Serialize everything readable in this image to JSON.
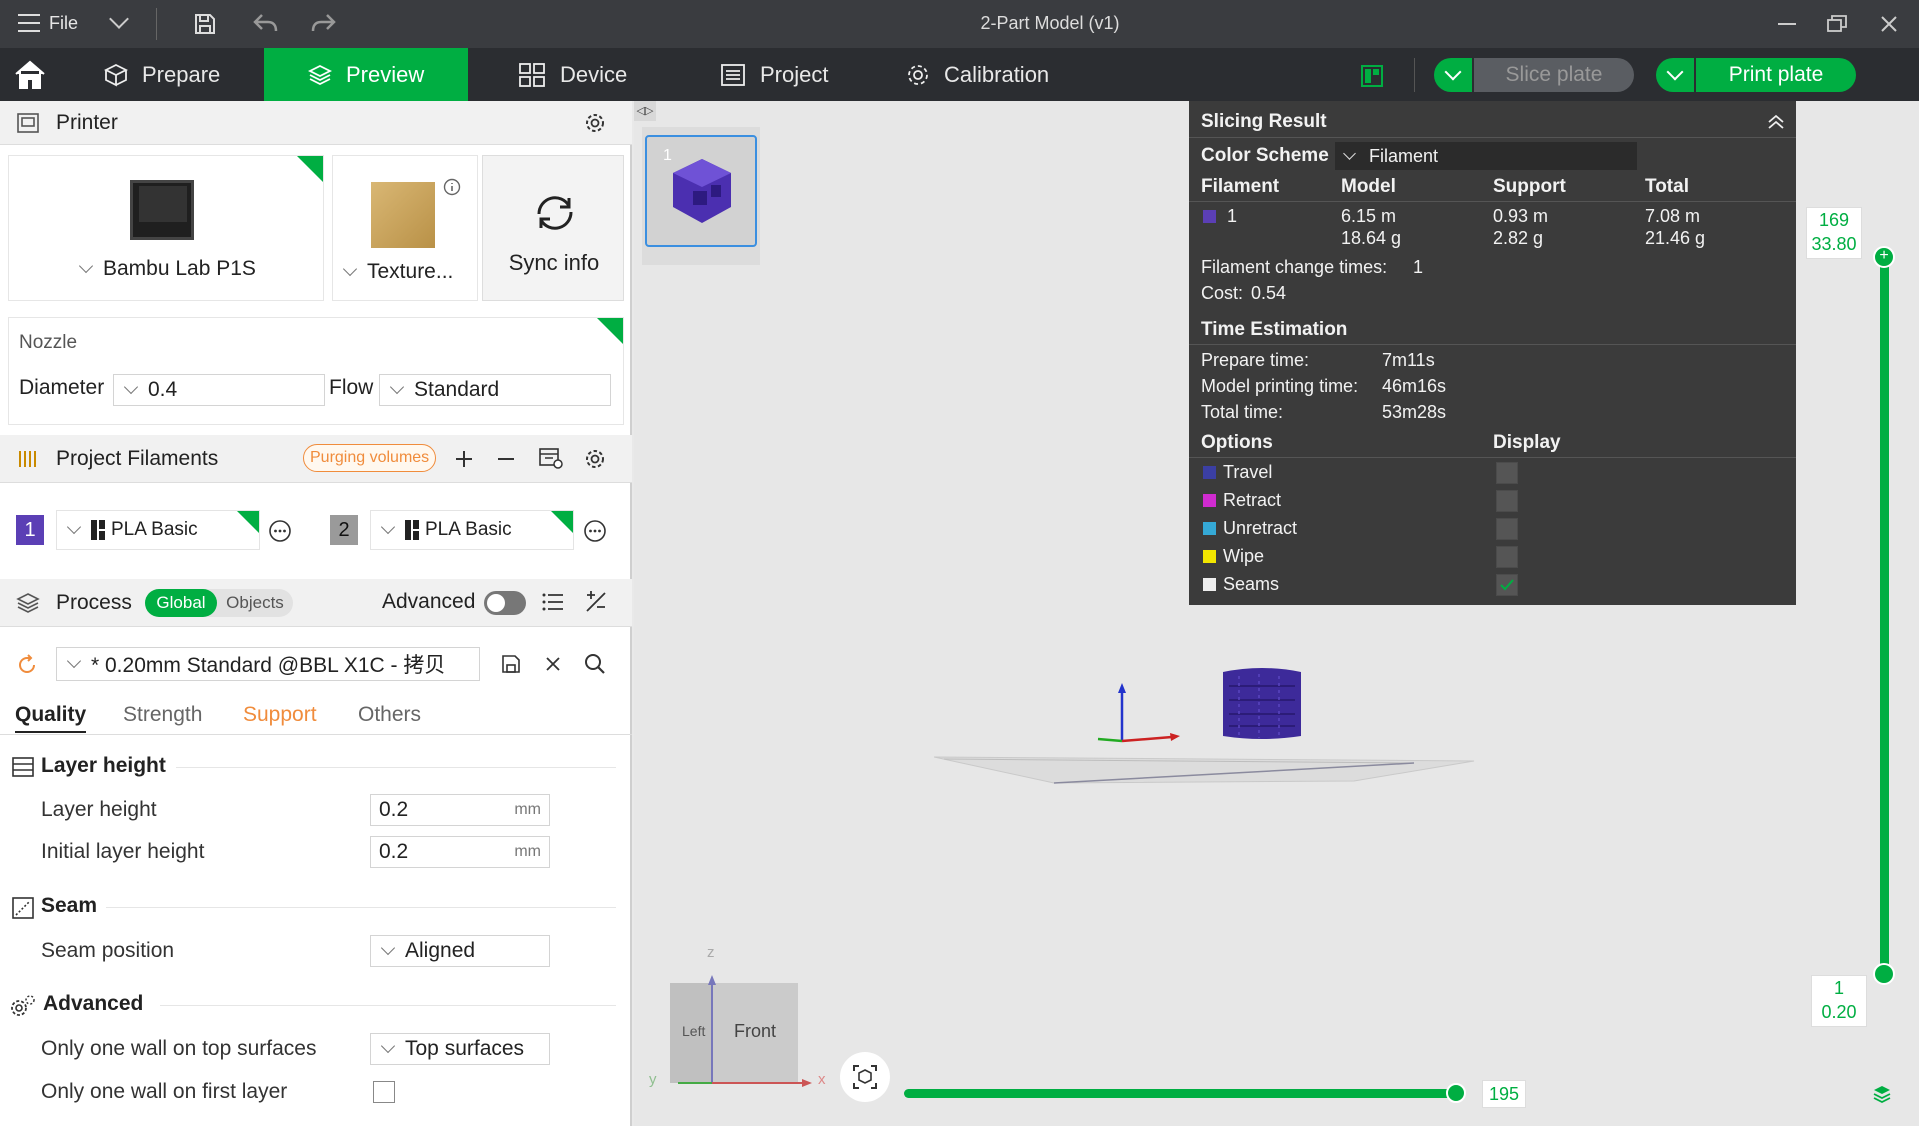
{
  "titlebar": {
    "menu_label": "File",
    "title": "2-Part Model (v1)"
  },
  "nav": {
    "tabs": [
      {
        "label": "Prepare"
      },
      {
        "label": "Preview"
      },
      {
        "label": "Device"
      },
      {
        "label": "Project"
      },
      {
        "label": "Calibration"
      }
    ],
    "slice_label": "Slice plate",
    "print_label": "Print plate"
  },
  "printer": {
    "section_title": "Printer",
    "printer_name": "Bambu Lab P1S",
    "plate_name": "Texture...",
    "sync_label": "Sync info",
    "nozzle_title": "Nozzle",
    "diameter_label": "Diameter",
    "diameter_value": "0.4",
    "flow_label": "Flow",
    "flow_value": "Standard"
  },
  "filaments": {
    "section_title": "Project Filaments",
    "purging_label": "Purging volumes",
    "items": [
      {
        "index": "1",
        "name": "PLA Basic",
        "color": "#5b3fb5"
      },
      {
        "index": "2",
        "name": "PLA Basic",
        "color": "#9a9a9a"
      }
    ]
  },
  "process": {
    "section_title": "Process",
    "toggle_global": "Global",
    "toggle_objects": "Objects",
    "advanced_label": "Advanced",
    "preset_name": "* 0.20mm Standard @BBL X1C - 拷贝",
    "tabs": [
      "Quality",
      "Strength",
      "Support",
      "Others"
    ],
    "groups": {
      "layer_height_title": "Layer height",
      "layer_height_label": "Layer height",
      "layer_height_value": "0.2",
      "layer_height_unit": "mm",
      "initial_layer_label": "Initial layer height",
      "initial_layer_value": "0.2",
      "initial_layer_unit": "mm",
      "seam_title": "Seam",
      "seam_position_label": "Seam position",
      "seam_position_value": "Aligned",
      "advanced_title": "Advanced",
      "one_wall_top_label": "Only one wall on top surfaces",
      "one_wall_top_value": "Top surfaces",
      "one_wall_first_label": "Only one wall on first layer"
    }
  },
  "slicing": {
    "title": "Slicing Result",
    "color_scheme_label": "Color Scheme",
    "color_scheme_value": "Filament",
    "headers": [
      "Filament",
      "Model",
      "Support",
      "Total"
    ],
    "filament_index": "1",
    "model_length": "6.15 m",
    "model_weight": "18.64 g",
    "support_length": "0.93 m",
    "support_weight": "2.82 g",
    "total_length": "7.08 m",
    "total_weight": "21.46 g",
    "change_times_label": "Filament change times:",
    "change_times_value": "1",
    "cost_label": "Cost:",
    "cost_value": "0.54",
    "time_title": "Time Estimation",
    "prepare_label": "Prepare time:",
    "prepare_value": "7m11s",
    "model_time_label": "Model printing time:",
    "model_time_value": "46m16s",
    "total_time_label": "Total time:",
    "total_time_value": "53m28s",
    "options_label": "Options",
    "display_label": "Display",
    "options": [
      {
        "label": "Travel",
        "color": "#3b3fa3",
        "checked": false
      },
      {
        "label": "Retract",
        "color": "#d02bd0",
        "checked": false
      },
      {
        "label": "Unretract",
        "color": "#35a9d6",
        "checked": false
      },
      {
        "label": "Wipe",
        "color": "#f2e600",
        "checked": false
      },
      {
        "label": "Seams",
        "color": "#eeeeee",
        "checked": true
      }
    ]
  },
  "viewport": {
    "plate_number": "1",
    "layer_top": "169",
    "layer_top_height": "33.80",
    "layer_bottom": "1",
    "layer_bottom_height": "0.20",
    "move_value": "195",
    "cube_left": "Left",
    "cube_front": "Front",
    "axis_z": "z",
    "axis_y": "y",
    "axis_x": "x"
  },
  "colors": {
    "accent": "#00ae42",
    "dark": "#2b2d31",
    "panel": "#3b3b3b"
  }
}
